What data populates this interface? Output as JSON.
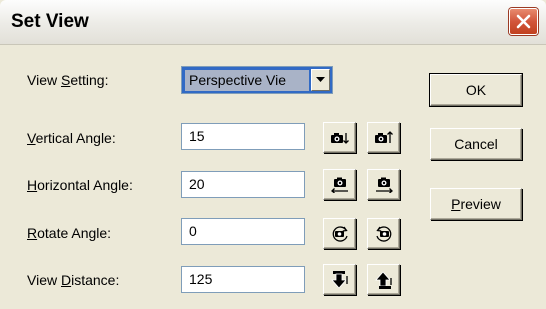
{
  "window": {
    "title": "Set View"
  },
  "fields": {
    "view_setting": {
      "label_pre": "View ",
      "label_key": "S",
      "label_post": "etting:",
      "value": "Perspective Vie"
    },
    "vertical_angle": {
      "label_pre": "",
      "label_key": "V",
      "label_post": "ertical Angle:",
      "value": "15"
    },
    "horizontal_angle": {
      "label_pre": "",
      "label_key": "H",
      "label_post": "orizontal Angle:",
      "value": "20"
    },
    "rotate_angle": {
      "label_pre": "",
      "label_key": "R",
      "label_post": "otate Angle:",
      "value": "0"
    },
    "view_distance": {
      "label_pre": "View ",
      "label_key": "D",
      "label_post": "istance:",
      "value": "125"
    }
  },
  "buttons": {
    "ok": {
      "label": "OK"
    },
    "cancel": {
      "label": "Cancel"
    },
    "preview": {
      "key": "P",
      "rest": "review"
    }
  },
  "icons": {
    "vertical_down": "camera-tilt-down-icon",
    "vertical_up": "camera-tilt-up-icon",
    "horizontal_left": "camera-pan-left-icon",
    "horizontal_right": "camera-pan-right-icon",
    "rotate_ccw": "camera-rotate-ccw-icon",
    "rotate_cw": "camera-rotate-cw-icon",
    "distance_in": "move-closer-icon",
    "distance_out": "move-away-icon"
  }
}
